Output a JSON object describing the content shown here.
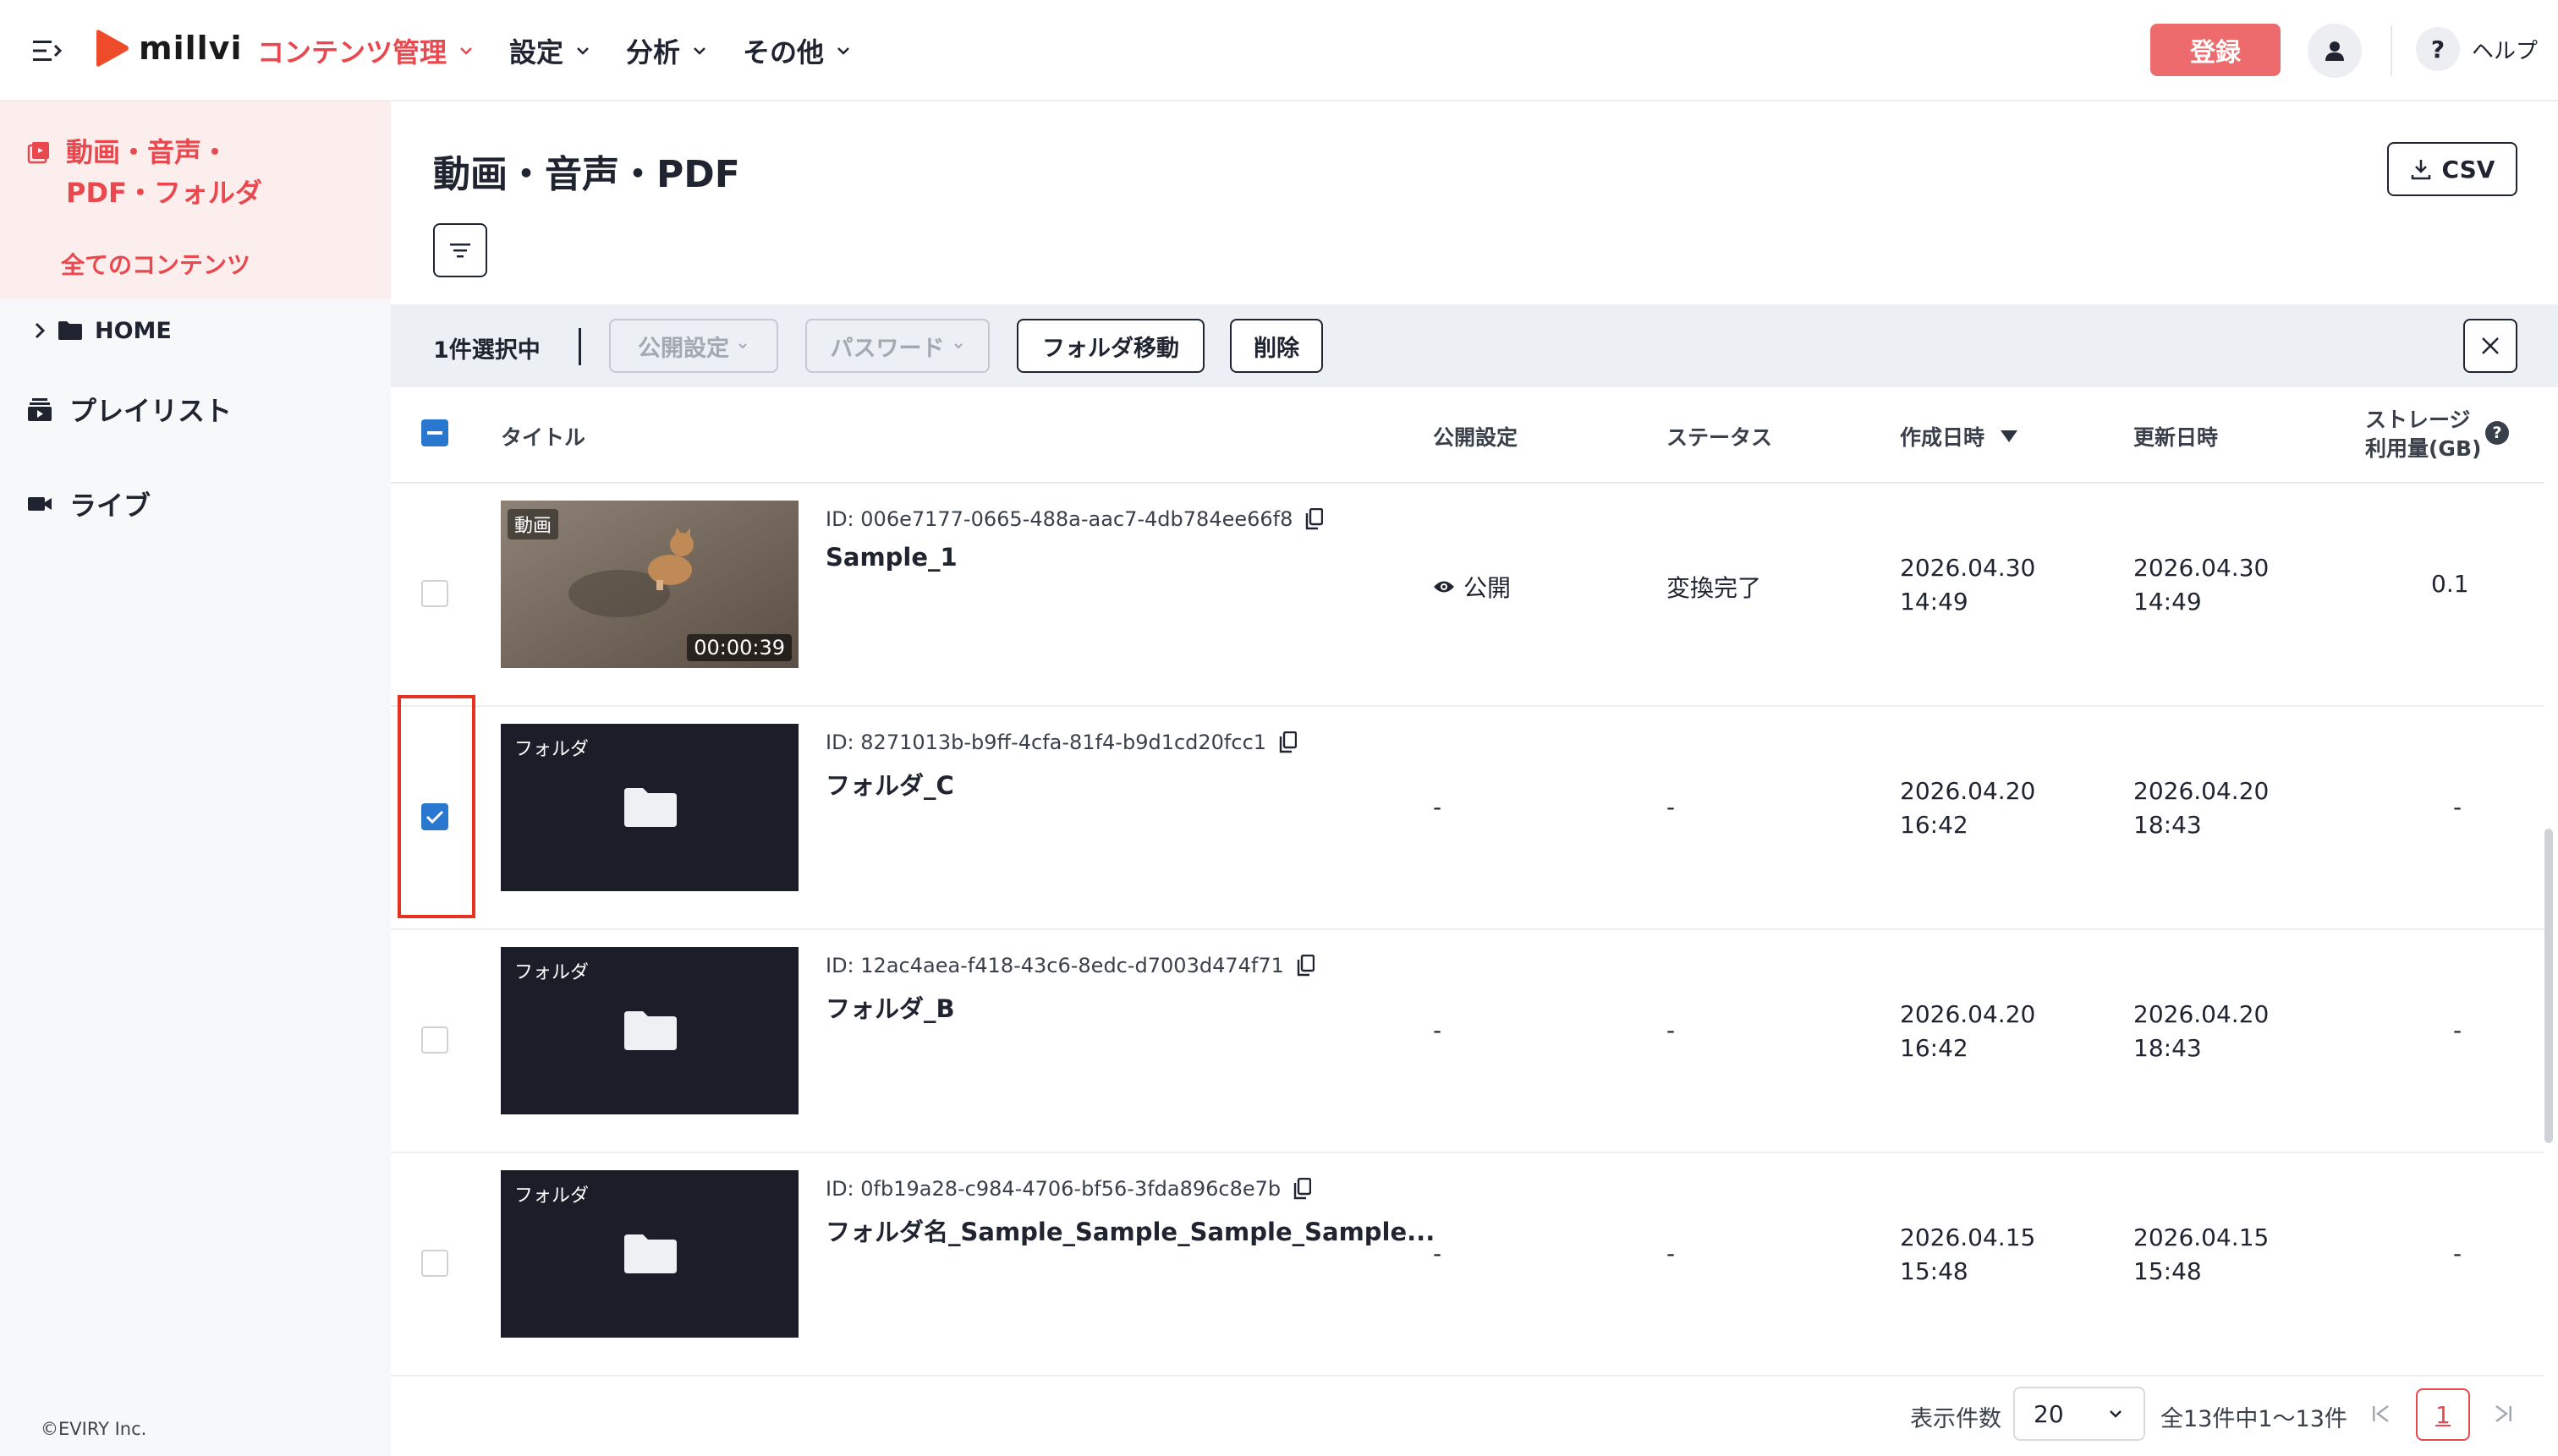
{
  "header": {
    "logo_text": "millvi",
    "nav": [
      {
        "label": "コンテンツ管理",
        "active": true
      },
      {
        "label": "設定",
        "active": false
      },
      {
        "label": "分析",
        "active": false
      },
      {
        "label": "その他",
        "active": false
      }
    ],
    "register_label": "登録",
    "help_label": "ヘルプ",
    "help_symbol": "?",
    "accent_color": "#e8484e"
  },
  "sidebar": {
    "group_title_line1": "動画・音声・",
    "group_title_line2": "PDF・フォルダ",
    "all_contents": "全てのコンテンツ",
    "home": "HOME",
    "playlist": "プレイリスト",
    "live": "ライブ",
    "copyright": "©EVIRY Inc."
  },
  "main": {
    "title": "動画・音声・PDF",
    "csv_label": "CSV"
  },
  "action_bar": {
    "selected_count": "1件選択中",
    "publish_setting": "公開設定",
    "password": "パスワード",
    "move_folder": "フォルダ移動",
    "delete": "削除"
  },
  "table": {
    "headers": {
      "title": "タイトル",
      "publish": "公開設定",
      "status": "ステータス",
      "created": "作成日時",
      "updated": "更新日時",
      "storage_line1": "ストレージ",
      "storage_line2": "利用量(GB)"
    },
    "rows": [
      {
        "type_tag": "動画",
        "duration": "00:00:39",
        "id": "ID: 006e7177-0665-488a-aac7-4db784ee66f8",
        "title": "Sample_1",
        "publish": "公開",
        "status": "変換完了",
        "created_date": "2026.04.30",
        "created_time": "14:49",
        "updated_date": "2026.04.30",
        "updated_time": "14:49",
        "storage": "0.1",
        "checked": false
      },
      {
        "type_tag": "フォルダ",
        "id": "ID: 8271013b-b9ff-4cfa-81f4-b9d1cd20fcc1",
        "title": "フォルダ_C",
        "publish": "-",
        "status": "-",
        "created_date": "2026.04.20",
        "created_time": "16:42",
        "updated_date": "2026.04.20",
        "updated_time": "18:43",
        "storage": "-",
        "checked": true
      },
      {
        "type_tag": "フォルダ",
        "id": "ID: 12ac4aea-f418-43c6-8edc-d7003d474f71",
        "title": "フォルダ_B",
        "publish": "-",
        "status": "-",
        "created_date": "2026.04.20",
        "created_time": "16:42",
        "updated_date": "2026.04.20",
        "updated_time": "18:43",
        "storage": "-",
        "checked": false
      },
      {
        "type_tag": "フォルダ",
        "id": "ID: 0fb19a28-c984-4706-bf56-3fda896c8e7b",
        "title": "フォルダ名_Sample_Sample_Sample_Sample...",
        "publish": "-",
        "status": "-",
        "created_date": "2026.04.15",
        "created_time": "15:48",
        "updated_date": "2026.04.15",
        "updated_time": "15:48",
        "storage": "-",
        "checked": false
      }
    ]
  },
  "pagination": {
    "per_page_label": "表示件数",
    "per_page_value": "20",
    "info": "全13件中1〜13件",
    "current_page": "1"
  }
}
